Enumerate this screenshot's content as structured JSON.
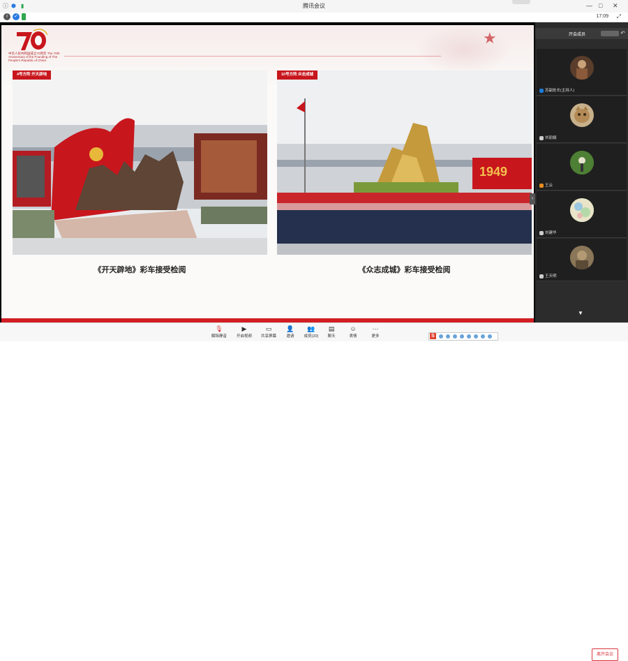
{
  "window": {
    "title": "腾讯会议",
    "clock": "17:09",
    "status_icon": "signal-icon",
    "controls": [
      "—",
      "□",
      "✕"
    ]
  },
  "slide": {
    "logo_number": "70",
    "logo_text": "中华人民共和国成立70周年 The 70th Anniversary of the Founding of The People's Republic of China",
    "left": {
      "tag": "4号方阵 开天辟地",
      "caption": "《开天辟地》彩车接受检阅"
    },
    "right": {
      "tag": "10号方阵 众志成城",
      "caption": "《众志成城》彩车接受检阅",
      "banner_year": "1949"
    }
  },
  "participants": {
    "header_label": "开会成员",
    "tiles": [
      {
        "name": "苏副处长(主持人)",
        "role": "host"
      },
      {
        "name": "刘丽娟",
        "role": "member"
      },
      {
        "name": "王云",
        "role": "member"
      },
      {
        "name": "刘建华",
        "role": "member"
      },
      {
        "name": "王天明",
        "role": "member"
      }
    ],
    "more": "▼"
  },
  "toolbar": {
    "buttons": [
      {
        "label": "解除静音",
        "icon": "mic-icon"
      },
      {
        "label": "开启视频",
        "icon": "camera-icon"
      },
      {
        "label": "共享屏幕",
        "icon": "screen-share-icon"
      },
      {
        "label": "邀请",
        "icon": "invite-icon"
      },
      {
        "label": "成员(20)",
        "icon": "members-icon"
      },
      {
        "label": "聊天",
        "icon": "chat-icon"
      },
      {
        "label": "表情",
        "icon": "emoji-icon"
      },
      {
        "label": "更多",
        "icon": "more-icon"
      }
    ],
    "leave": "离开会议"
  },
  "colors": {
    "brand_red": "#c8161d",
    "sidebar_bg": "#2c2c2c",
    "leave_red": "#d9363e"
  }
}
